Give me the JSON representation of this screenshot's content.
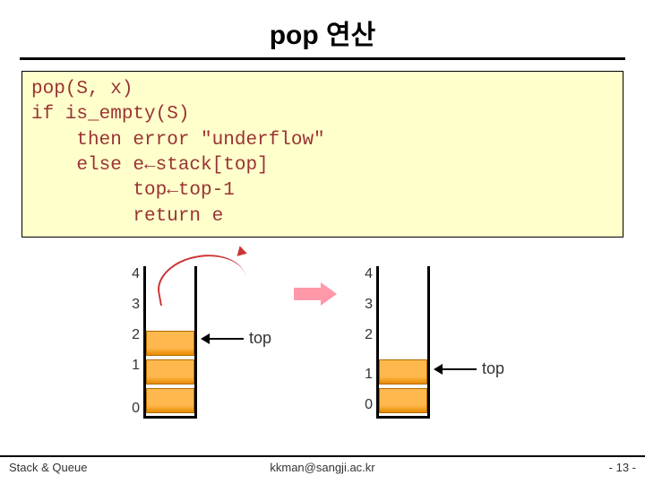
{
  "title": "pop 연산",
  "code": "pop(S, x)\nif is_empty(S)\n    then error \"underflow\"\n    else e←stack[top]\n         top←top-1\n         return e",
  "diagram": {
    "indices": [
      "4",
      "3",
      "2",
      "1",
      "0"
    ],
    "top_label": "top",
    "left_filled_upto": 2,
    "right_filled_upto": 1
  },
  "footer": {
    "left": "Stack & Queue",
    "center": "kkman@sangji.ac.kr",
    "right": "- 13 -"
  }
}
